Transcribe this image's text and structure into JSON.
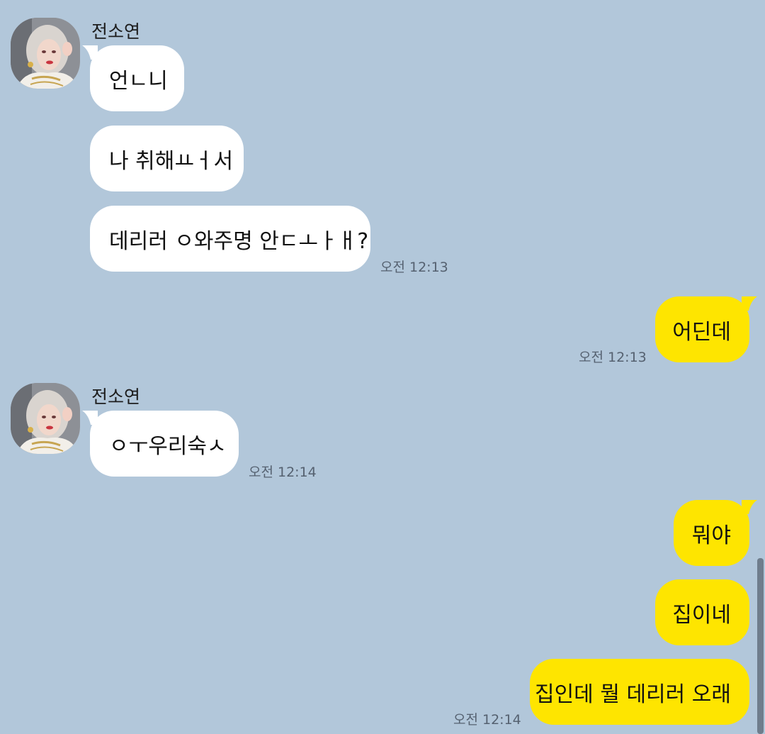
{
  "chat": {
    "sender_name": "전소연",
    "colors": {
      "background": "#b2c7da",
      "incoming_bubble": "#ffffff",
      "outgoing_bubble": "#fee500",
      "timestamp": "#556170"
    },
    "icons": {
      "avatar": "profile-photo"
    },
    "messages": [
      {
        "direction": "in",
        "text": "언ㄴ니"
      },
      {
        "direction": "in",
        "text": "나 취해ㅛㅓ서"
      },
      {
        "direction": "in",
        "text": "데리러 ㅇ와주명 안ㄷㅗㅏㅐ?",
        "time": "오전 12:13"
      },
      {
        "direction": "out",
        "text": "어딘데",
        "time": "오전 12:13"
      },
      {
        "direction": "in",
        "text": "ㅇㅜ우리숙ㅅ",
        "time": "오전 12:14"
      },
      {
        "direction": "out",
        "text": "뭐야"
      },
      {
        "direction": "out",
        "text": "집이네"
      },
      {
        "direction": "out",
        "text": "집인데 뭘 데리러 오래",
        "time": "오전 12:14"
      }
    ]
  }
}
